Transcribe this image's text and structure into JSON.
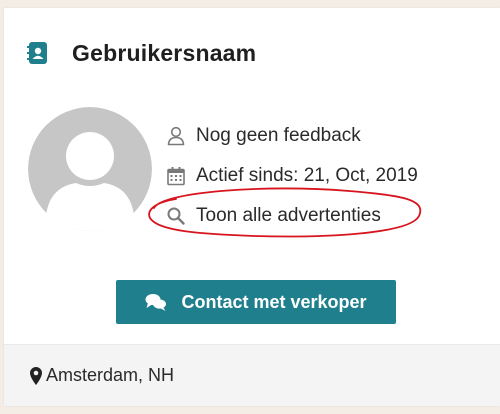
{
  "seller": {
    "name": "Gebruikersnaam",
    "profile_icon": "address-book-icon",
    "avatar": "default-avatar"
  },
  "info": {
    "feedback": {
      "icon": "user-outline-icon",
      "text": "Nog geen feedback"
    },
    "active_since": {
      "icon": "calendar-icon",
      "text": "Actief sinds: 21, Oct, 2019"
    },
    "all_ads": {
      "icon": "search-icon",
      "text": "Toon alle advertenties"
    }
  },
  "contact_button": {
    "icon": "comments-icon",
    "label": "Contact met verkoper"
  },
  "location": {
    "icon": "map-marker-icon",
    "text": "Amsterdam, NH"
  },
  "colors": {
    "accent": "#1f7f8c",
    "annotation": "#d8141e",
    "avatar_gray": "#c6c6c6"
  }
}
